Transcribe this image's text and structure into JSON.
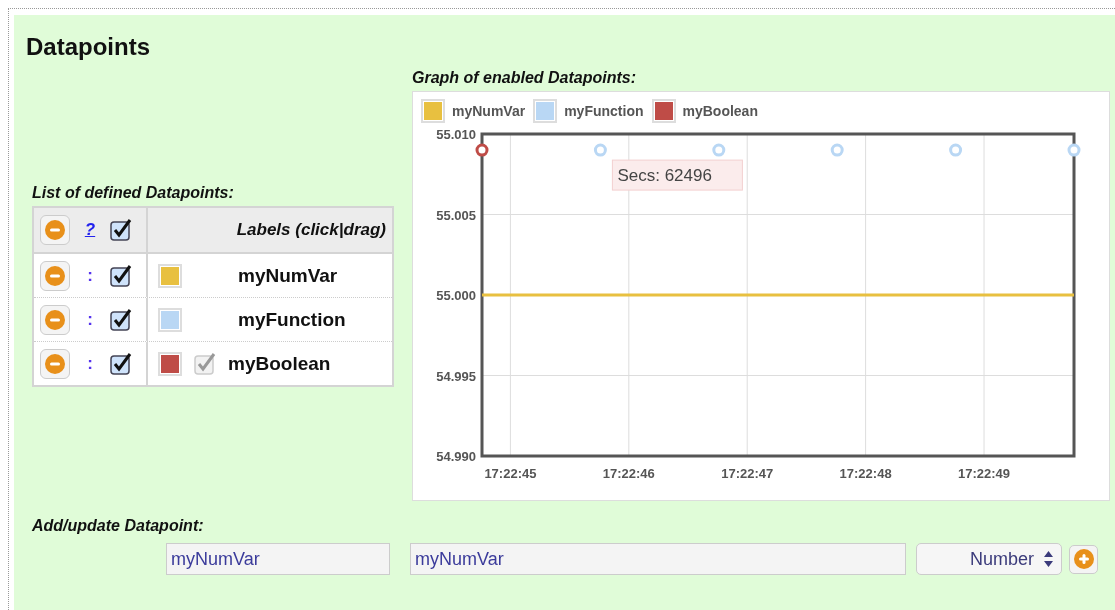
{
  "title": "Datapoints",
  "list": {
    "heading": "List of defined Datapoints:",
    "header": {
      "help": "?",
      "checked": true,
      "labels": "Labels (click|drag)"
    },
    "rows": [
      {
        "separator": ":",
        "checked": true,
        "color": "#e8c040",
        "kind": "plain",
        "label": "myNumVar"
      },
      {
        "separator": ":",
        "checked": true,
        "color": "#b9d7f4",
        "kind": "plain",
        "label": "myFunction"
      },
      {
        "separator": ":",
        "checked": true,
        "color": "#bf4c47",
        "kind": "flag",
        "flag_checked": true,
        "label": "myBoolean"
      }
    ]
  },
  "graph": {
    "heading": "Graph of enabled Datapoints:",
    "tooltip": "Secs: 62496",
    "chart_data": {
      "type": "line",
      "grid": true,
      "x": [
        62564.76,
        62565.76,
        62566.76,
        62567.76,
        62568.76,
        62569.76
      ],
      "series": [
        {
          "name": "myNumVar",
          "color": "#e8c040",
          "values": [
            55.0,
            55.0,
            55.0,
            55.0,
            55.0,
            55.0
          ]
        },
        {
          "name": "myFunction",
          "type": "scatter",
          "color": "#b9d7f4",
          "values": [
            null,
            55.009,
            55.009,
            55.009,
            55.009,
            55.009
          ]
        },
        {
          "name": "myBoolean",
          "type": "scatter",
          "color": "#bf4c47",
          "values": [
            55.009,
            null,
            null,
            null,
            null,
            null
          ]
        }
      ],
      "xlim": [
        62564.76,
        62569.76
      ],
      "ylim": [
        54.99,
        55.01
      ],
      "xticks": [
        {
          "value": 62565,
          "label": "17:22:45"
        },
        {
          "value": 62566,
          "label": "17:22:46"
        },
        {
          "value": 62567,
          "label": "17:22:47"
        },
        {
          "value": 62568,
          "label": "17:22:48"
        },
        {
          "value": 62569,
          "label": "17:22:49"
        }
      ],
      "yticks": [
        {
          "value": 55.01,
          "label": "55.010"
        },
        {
          "value": 55.005,
          "label": "55.005"
        },
        {
          "value": 55.0,
          "label": "55.000"
        },
        {
          "value": 54.995,
          "label": "54.995"
        },
        {
          "value": 54.99,
          "label": "54.990"
        }
      ]
    }
  },
  "add": {
    "heading": "Add/update Datapoint:",
    "name_value": "myNumVar",
    "label_value": "myNumVar",
    "type": "Number"
  }
}
